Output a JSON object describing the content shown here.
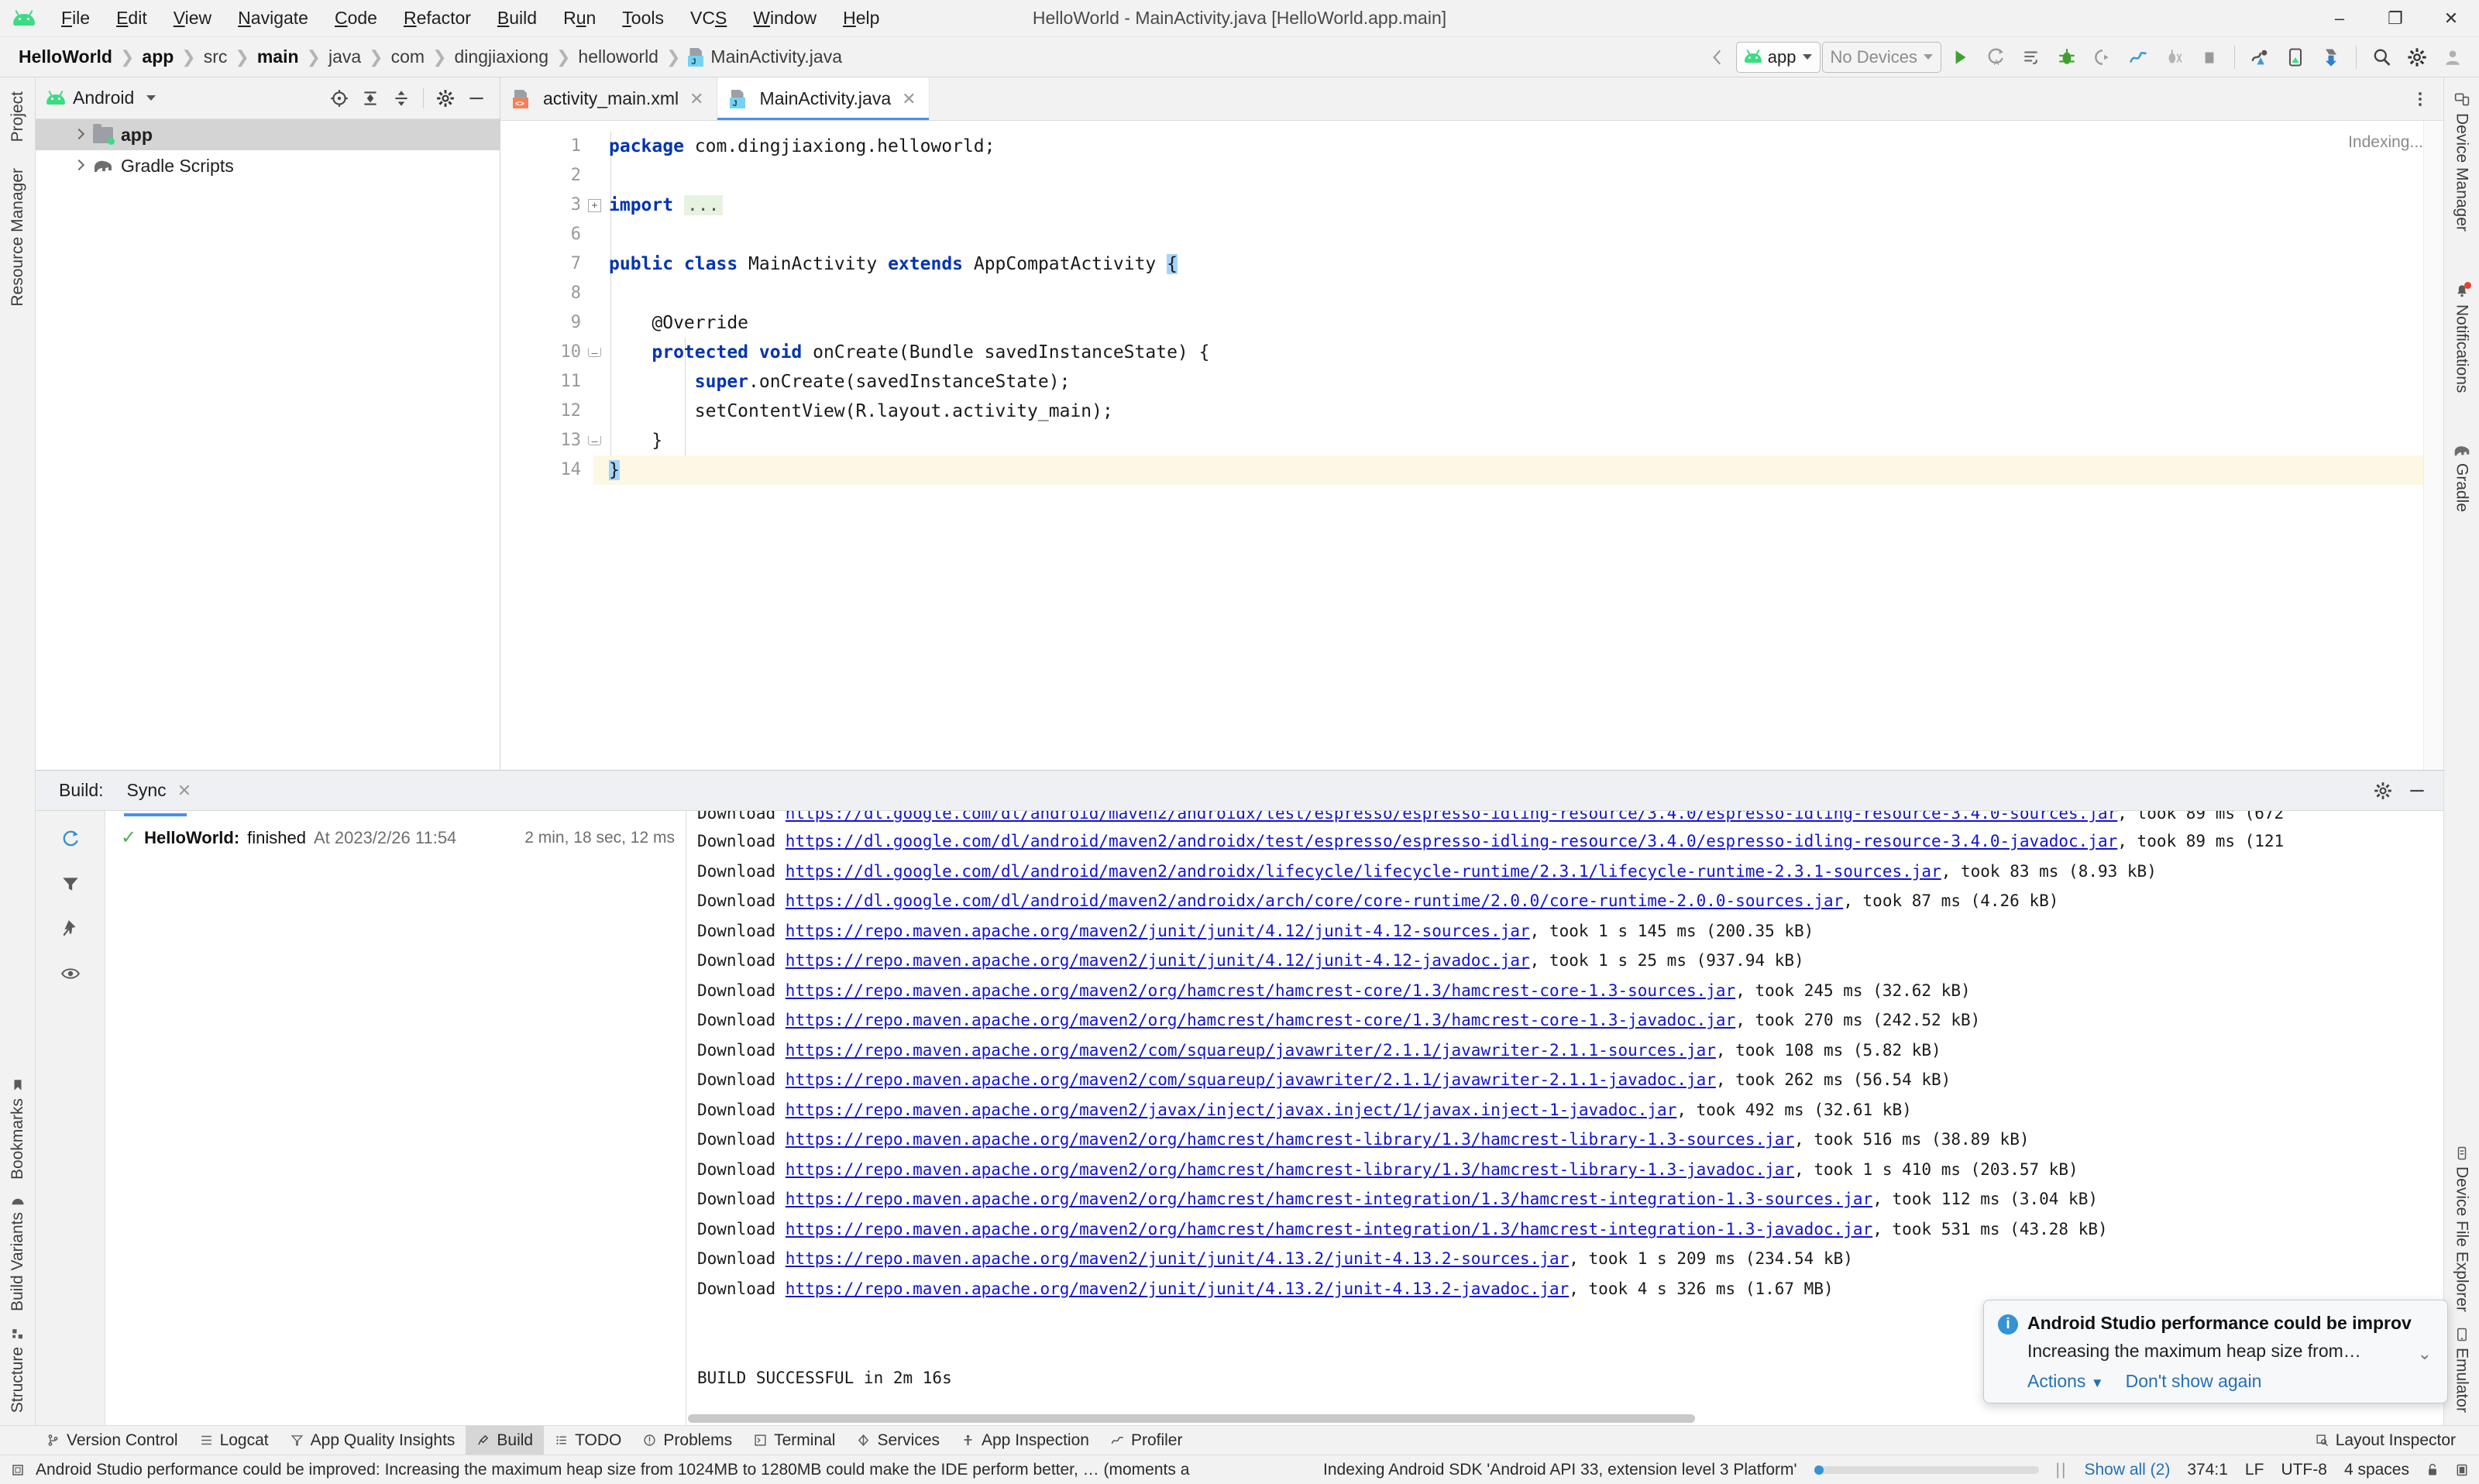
{
  "window": {
    "title": "HelloWorld - MainActivity.java [HelloWorld.app.main]",
    "minimize": "–",
    "maximize": "❐",
    "close": "✕"
  },
  "menubar": {
    "logo": "android-logo-icon",
    "items": [
      "File",
      "Edit",
      "View",
      "Navigate",
      "Code",
      "Refactor",
      "Build",
      "Run",
      "Tools",
      "VCS",
      "Window",
      "Help"
    ]
  },
  "breadcrumb": {
    "items": [
      "HelloWorld",
      "app",
      "src",
      "main",
      "java",
      "com",
      "dingjiaxiong",
      "helloworld",
      "MainActivity.java"
    ],
    "separator": "›",
    "bold_indices": [
      0,
      1,
      3
    ]
  },
  "toolbar": {
    "back_label": "back-icon",
    "run_config": "app",
    "device_selector": "No Devices",
    "buttons": [
      "run-button",
      "apply-changes-button",
      "apply-code-changes-button",
      "debug-button",
      "attach-debugger-button",
      "profiler-button",
      "run-with-coverage-button",
      "stop-button",
      "sdk-manager-button",
      "avd-manager-button",
      "sync-project-button",
      "search-button",
      "settings-button",
      "account-button"
    ]
  },
  "project_panel": {
    "view_name": "Android",
    "header_buttons": [
      "select-opened-file-icon",
      "expand-all-icon",
      "collapse-all-icon",
      "settings-icon",
      "hide-icon"
    ],
    "tree": [
      {
        "label": "app",
        "bold": true,
        "selected": true,
        "icon": "module-folder-icon"
      },
      {
        "label": "Gradle Scripts",
        "bold": false,
        "selected": false,
        "icon": "gradle-elephant-icon"
      }
    ]
  },
  "left_toolbar": {
    "tabs": [
      "Project",
      "Resource Manager"
    ],
    "bottom_tabs": [
      "Bookmarks",
      "Build Variants",
      "Structure"
    ]
  },
  "right_toolbar": {
    "tabs": [
      "Device Manager",
      "Notifications",
      "Gradle"
    ],
    "bottom_tabs": [
      "Device File Explorer",
      "Emulator"
    ]
  },
  "editor": {
    "tabs": [
      {
        "label": "activity_main.xml",
        "active": false,
        "icon": "xml-file-icon",
        "letter": "<>"
      },
      {
        "label": "MainActivity.java",
        "active": true,
        "icon": "java-file-icon",
        "letter": "J"
      }
    ],
    "indexing_label": "Indexing...",
    "lines": [
      {
        "num": "1",
        "text": "package com.dingjiaxiong.helloworld;",
        "kw": "package"
      },
      {
        "num": "2",
        "text": ""
      },
      {
        "num": "3",
        "text": "import ...",
        "kw": "import",
        "fold": true
      },
      {
        "num": "6",
        "text": ""
      },
      {
        "num": "7",
        "text": "public class MainActivity extends AppCompatActivity {"
      },
      {
        "num": "8",
        "text": ""
      },
      {
        "num": "9",
        "text": "    @Override"
      },
      {
        "num": "10",
        "text": "    protected void onCreate(Bundle savedInstanceState) {"
      },
      {
        "num": "11",
        "text": "        super.onCreate(savedInstanceState);"
      },
      {
        "num": "12",
        "text": "        setContentView(R.layout.activity_main);"
      },
      {
        "num": "13",
        "text": "    }"
      },
      {
        "num": "14",
        "text": "}",
        "current": true
      }
    ]
  },
  "build_panel": {
    "label": "Build:",
    "tab": "Sync",
    "tab_close": "✕",
    "toolbar_buttons": [
      "restart-sync-icon",
      "filter-icon",
      "pin-icon",
      "eye-icon"
    ],
    "header_right": [
      "settings-icon",
      "hide-icon"
    ],
    "tree_row": {
      "check": "✓",
      "name": "HelloWorld:",
      "status": "finished",
      "at": "At 2023/2/26 11:54",
      "duration": "2 min, 18 sec, 12 ms"
    },
    "log_lines": [
      {
        "clipped": true,
        "prefix": "Download ",
        "url": "https://dl.google.com/dl/android/maven2/androidx/test/espresso/espresso-idling-resource/3.4.0/espresso-idling-resource-3.4.0-sources.jar",
        "meta": ", took 89 ms (672"
      },
      {
        "prefix": "Download ",
        "url": "https://dl.google.com/dl/android/maven2/androidx/test/espresso/espresso-idling-resource/3.4.0/espresso-idling-resource-3.4.0-javadoc.jar",
        "meta": ", took 89 ms (121"
      },
      {
        "prefix": "Download ",
        "url": "https://dl.google.com/dl/android/maven2/androidx/lifecycle/lifecycle-runtime/2.3.1/lifecycle-runtime-2.3.1-sources.jar",
        "meta": ", took 83 ms (8.93 kB)"
      },
      {
        "prefix": "Download ",
        "url": "https://dl.google.com/dl/android/maven2/androidx/arch/core/core-runtime/2.0.0/core-runtime-2.0.0-sources.jar",
        "meta": ", took 87 ms (4.26 kB)"
      },
      {
        "prefix": "Download ",
        "url": "https://repo.maven.apache.org/maven2/junit/junit/4.12/junit-4.12-sources.jar",
        "meta": ", took 1 s 145 ms (200.35 kB)"
      },
      {
        "prefix": "Download ",
        "url": "https://repo.maven.apache.org/maven2/junit/junit/4.12/junit-4.12-javadoc.jar",
        "meta": ", took 1 s 25 ms (937.94 kB)"
      },
      {
        "prefix": "Download ",
        "url": "https://repo.maven.apache.org/maven2/org/hamcrest/hamcrest-core/1.3/hamcrest-core-1.3-sources.jar",
        "meta": ", took 245 ms (32.62 kB)"
      },
      {
        "prefix": "Download ",
        "url": "https://repo.maven.apache.org/maven2/org/hamcrest/hamcrest-core/1.3/hamcrest-core-1.3-javadoc.jar",
        "meta": ", took 270 ms (242.52 kB)"
      },
      {
        "prefix": "Download ",
        "url": "https://repo.maven.apache.org/maven2/com/squareup/javawriter/2.1.1/javawriter-2.1.1-sources.jar",
        "meta": ", took 108 ms (5.82 kB)"
      },
      {
        "prefix": "Download ",
        "url": "https://repo.maven.apache.org/maven2/com/squareup/javawriter/2.1.1/javawriter-2.1.1-javadoc.jar",
        "meta": ", took 262 ms (56.54 kB)"
      },
      {
        "prefix": "Download ",
        "url": "https://repo.maven.apache.org/maven2/javax/inject/javax.inject/1/javax.inject-1-javadoc.jar",
        "meta": ", took 492 ms (32.61 kB)"
      },
      {
        "prefix": "Download ",
        "url": "https://repo.maven.apache.org/maven2/org/hamcrest/hamcrest-library/1.3/hamcrest-library-1.3-sources.jar",
        "meta": ", took 516 ms (38.89 kB)"
      },
      {
        "prefix": "Download ",
        "url": "https://repo.maven.apache.org/maven2/org/hamcrest/hamcrest-library/1.3/hamcrest-library-1.3-javadoc.jar",
        "meta": ", took 1 s 410 ms (203.57 kB)"
      },
      {
        "prefix": "Download ",
        "url": "https://repo.maven.apache.org/maven2/org/hamcrest/hamcrest-integration/1.3/hamcrest-integration-1.3-sources.jar",
        "meta": ", took 112 ms (3.04 kB)"
      },
      {
        "prefix": "Download ",
        "url": "https://repo.maven.apache.org/maven2/org/hamcrest/hamcrest-integration/1.3/hamcrest-integration-1.3-javadoc.jar",
        "meta": ", took 531 ms (43.28 kB)"
      },
      {
        "prefix": "Download ",
        "url": "https://repo.maven.apache.org/maven2/junit/junit/4.13.2/junit-4.13.2-sources.jar",
        "meta": ", took 1 s 209 ms (234.54 kB)"
      },
      {
        "prefix": "Download ",
        "url": "https://repo.maven.apache.org/maven2/junit/junit/4.13.2/junit-4.13.2-javadoc.jar",
        "meta": ", took 4 s 326 ms (1.67 MB)"
      },
      {
        "blank": true
      },
      {
        "blank": true
      },
      {
        "plain": "BUILD SUCCESSFUL in 2m 16s"
      }
    ]
  },
  "notification": {
    "icon": "info-icon",
    "title": "Android Studio performance could be improv",
    "subtitle": "Increasing the maximum heap size from…",
    "actions_label": "Actions",
    "dismiss_label": "Don't show again",
    "collapse_icon": "chevron-down-icon"
  },
  "bottom_bar": {
    "items": [
      {
        "label": "Version Control",
        "icon": "branch-icon",
        "active": false
      },
      {
        "label": "Logcat",
        "icon": "logcat-icon",
        "active": false
      },
      {
        "label": "App Quality Insights",
        "icon": "insights-icon",
        "active": false
      },
      {
        "label": "Build",
        "icon": "build-hammer-icon",
        "active": true
      },
      {
        "label": "TODO",
        "icon": "todo-list-icon",
        "active": false
      },
      {
        "label": "Problems",
        "icon": "problems-icon",
        "active": false
      },
      {
        "label": "Terminal",
        "icon": "terminal-icon",
        "active": false
      },
      {
        "label": "Services",
        "icon": "services-icon",
        "active": false
      },
      {
        "label": "App Inspection",
        "icon": "inspection-icon",
        "active": false
      },
      {
        "label": "Profiler",
        "icon": "profiler-icon",
        "active": false
      }
    ],
    "right": {
      "label": "Layout Inspector",
      "icon": "layout-inspector-icon"
    }
  },
  "status_bar": {
    "message": "Android Studio performance could be improved: Increasing the maximum heap size from 1024MB to 1280MB could make the IDE perform better, … (moments a",
    "indexing": "Indexing Android SDK 'Android API 33, extension level 3 Platform'",
    "show_all": "Show all (2)",
    "caret": "374:1",
    "line_sep": "LF",
    "encoding": "UTF-8",
    "indent": "4 spaces",
    "lock_icon": "lock-icon",
    "memory_icon": "memory-icon"
  },
  "colors": {
    "accent": "#4a8df8",
    "android_green": "#3ddc84",
    "link": "#1414cc",
    "success": "#4caf50",
    "current_line": "#fdf8e3",
    "info": "#3592d4"
  }
}
